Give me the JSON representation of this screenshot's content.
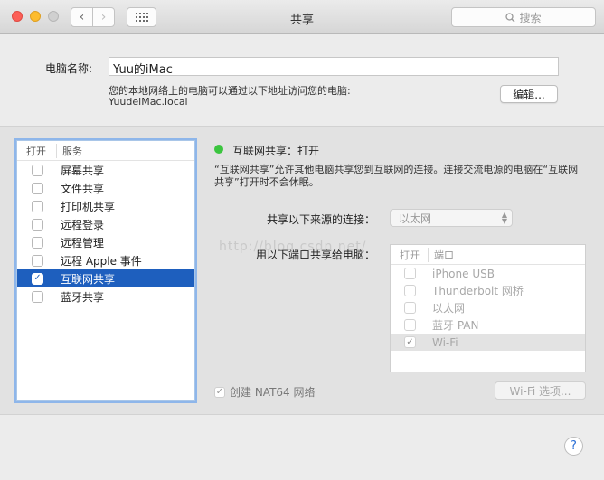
{
  "window": {
    "title": "共享"
  },
  "toolbar": {
    "back": "‹",
    "forward": "›"
  },
  "search": {
    "placeholder": "搜索"
  },
  "computer": {
    "label": "电脑名称:",
    "name": "Yuu的iMac",
    "info_line1": "您的本地网络上的电脑可以通过以下地址访问您的电脑:",
    "info_line2": "YuudeiMac.local",
    "edit_label": "编辑..."
  },
  "services": {
    "col_on": "打开",
    "col_service": "服务",
    "items": [
      {
        "label": "屏幕共享",
        "checked": false,
        "selected": false
      },
      {
        "label": "文件共享",
        "checked": false,
        "selected": false
      },
      {
        "label": "打印机共享",
        "checked": false,
        "selected": false
      },
      {
        "label": "远程登录",
        "checked": false,
        "selected": false
      },
      {
        "label": "远程管理",
        "checked": false,
        "selected": false
      },
      {
        "label": "远程 Apple 事件",
        "checked": false,
        "selected": false
      },
      {
        "label": "互联网共享",
        "checked": true,
        "selected": true
      },
      {
        "label": "蓝牙共享",
        "checked": false,
        "selected": false
      }
    ]
  },
  "detail": {
    "status": "互联网共享：打开",
    "status_color": "#3bc53f",
    "description": "“互联网共享”允许其他电脑共享您到互联网的连接。连接交流电源的电脑在“互联网共享”打开时不会休眠。",
    "share_from_label": "共享以下来源的连接：",
    "share_from_value": "以太网",
    "share_to_label": "用以下端口共享给电脑：",
    "port_col_on": "打开",
    "port_col_port": "端口",
    "ports": [
      {
        "label": "iPhone USB",
        "checked": false,
        "selected": false
      },
      {
        "label": "Thunderbolt 网桥",
        "checked": false,
        "selected": false
      },
      {
        "label": "以太网",
        "checked": false,
        "selected": false
      },
      {
        "label": "蓝牙 PAN",
        "checked": false,
        "selected": false
      },
      {
        "label": "Wi-Fi",
        "checked": true,
        "selected": true
      }
    ],
    "nat64_label": "创建 NAT64 网络",
    "nat64_checked": true,
    "wifi_options_label": "Wi-Fi 选项..."
  },
  "watermark": "http://blog.csdn.net/",
  "help": "?"
}
